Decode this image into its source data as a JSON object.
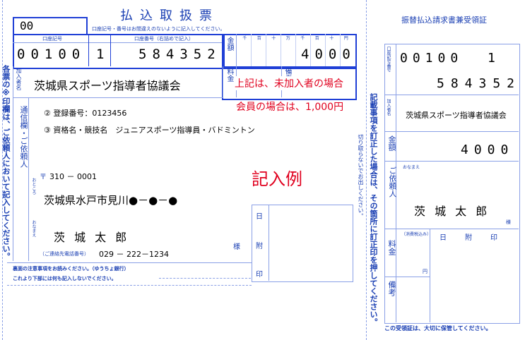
{
  "main_form": {
    "title": "払込取扱票",
    "code_box": "00",
    "instruction_top": "口座記号・番号はお間違えのないように記入してください。",
    "label_account_symbol": "口座記号",
    "label_account_number": "口座番号（右詰めで記入）",
    "account_symbol_digits": "00100",
    "account_check_digit": "1",
    "account_number": "584352",
    "label_amount": "金額",
    "amount_units": [
      "千",
      "百",
      "十",
      "万",
      "千",
      "百",
      "十",
      "円"
    ],
    "amount": "4000",
    "label_fee": "料金",
    "label_remarks": "備考",
    "label_payee": "加入者名",
    "payee_name": "茨城県スポーツ指導者協議会",
    "label_comm": "通信欄・ご依頼人",
    "comm_line1": "② 登録番号：0123456",
    "comm_line2": "③ 資格名・競技名　ジュニアスポーツ指導員・バドミントン",
    "postal_mark": "〒",
    "postal_code": "310 － 0001",
    "label_address": "おところ",
    "address": "茨城県水戸市見川●－●－●",
    "label_name": "おなまえ",
    "person_name": "茨 城 太 郎",
    "label_phone": "（ご連絡先電話番号）",
    "phone": "029 － 222－1234",
    "sama": "様",
    "date_label": "日",
    "stamp_label_1": "附",
    "stamp_label_2": "印",
    "footer1": "裏面の注意事項をお読みください。（ゆうちょ銀行）",
    "footer2": "これより下部には何も記入しないでください。",
    "left_vertical_note": "各票の※印欄は、ご依頼人において記入してください。"
  },
  "annotations": {
    "note_line1": "上記は、未加入者の場合",
    "note_line2": "会員の場合は、1,000円",
    "example": "記入例"
  },
  "middle_vertical": {
    "cut_note": "切り取らないでお出しください。",
    "correction_note": "記載事項を訂正した場合は、その箇所に訂正印を押してください。"
  },
  "receipt": {
    "title": "振替払込請求書兼受領証",
    "label_account": "口座記号番号",
    "account_symbol_digits": "00100",
    "account_check_digit": "1",
    "account_number": "584352",
    "label_payee": "加入者名",
    "payee_name": "茨城県スポーツ指導者協議会",
    "label_amount": "金額",
    "amount": "4000",
    "label_requester": "ご依頼人",
    "label_name": "おなまえ",
    "person_name": "茨 城 太 郎",
    "sama": "様",
    "label_tax": "（消費税込み）",
    "yen": "円",
    "date_label": "日",
    "stamp_label_1": "附",
    "stamp_label_2": "印",
    "label_fee": "料金",
    "label_remarks": "備考",
    "footer": "この受領証は、大切に保管してください。"
  }
}
